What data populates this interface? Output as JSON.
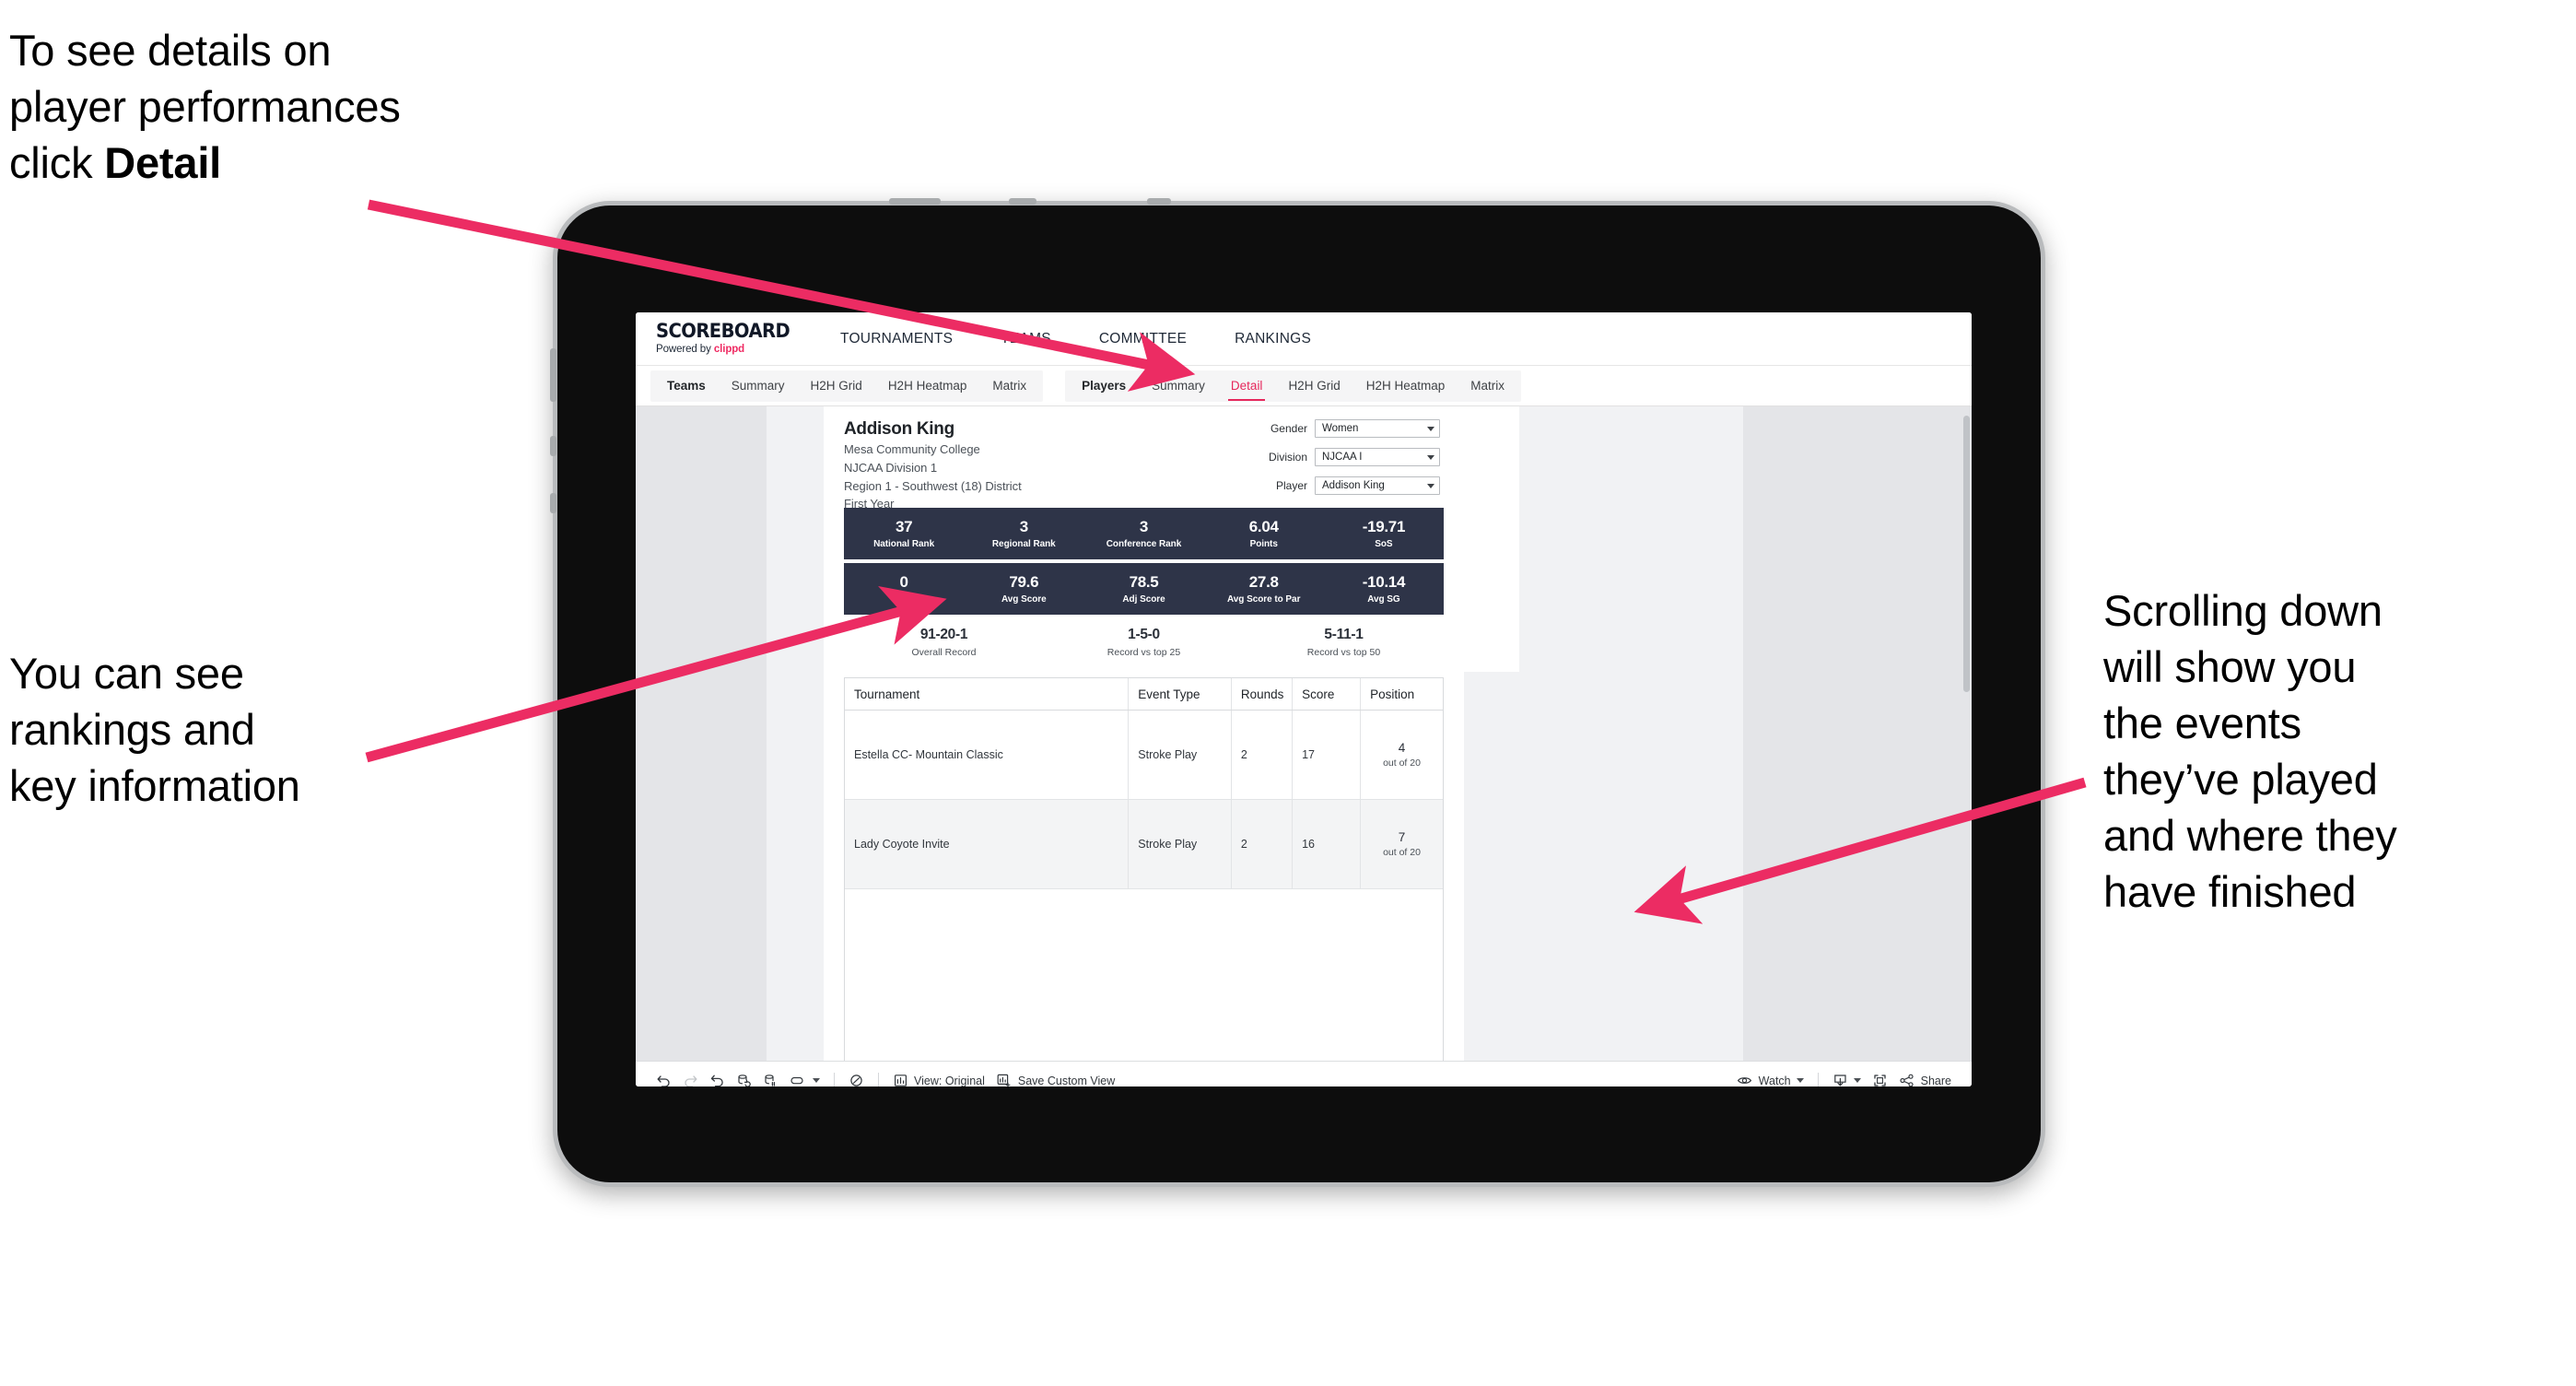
{
  "annotations": {
    "top_left": {
      "line1": "To see details on",
      "line2": "player performances",
      "line3_prefix": "click ",
      "line3_bold": "Detail"
    },
    "mid_left": "You can see\nrankings and\nkey information",
    "right": "Scrolling down\nwill show you\nthe events\nthey’ve played\nand where they\nhave finished"
  },
  "colors": {
    "arrow_pink": "#ec2c63",
    "accent_pink": "#e6285c",
    "band_navy": "#2e3448",
    "brand_pink": "#ef2b63"
  },
  "app": {
    "brand": {
      "title": "SCOREBOARD",
      "powered_prefix": "Powered by ",
      "powered_name": "clippd"
    },
    "top_nav": [
      {
        "label": "TOURNAMENTS"
      },
      {
        "label": "TEAMS"
      },
      {
        "label": "COMMITTEE"
      },
      {
        "label": "RANKINGS"
      }
    ],
    "sub_nav": {
      "teams_group": [
        {
          "label": "Teams",
          "lead": true,
          "active": false
        },
        {
          "label": "Summary",
          "lead": false,
          "active": false
        },
        {
          "label": "H2H Grid",
          "lead": false,
          "active": false
        },
        {
          "label": "H2H Heatmap",
          "lead": false,
          "active": false
        },
        {
          "label": "Matrix",
          "lead": false,
          "active": false
        }
      ],
      "players_group": [
        {
          "label": "Players",
          "lead": true,
          "active": false
        },
        {
          "label": "Summary",
          "lead": false,
          "active": false
        },
        {
          "label": "Detail",
          "lead": false,
          "active": true
        },
        {
          "label": "H2H Grid",
          "lead": false,
          "active": false
        },
        {
          "label": "H2H Heatmap",
          "lead": false,
          "active": false
        },
        {
          "label": "Matrix",
          "lead": false,
          "active": false
        }
      ]
    }
  },
  "player": {
    "name": "Addison King",
    "school": "Mesa Community College",
    "division": "NJCAA Division 1",
    "region": "Region 1 - Southwest (18) District",
    "class_year": "First Year"
  },
  "filters": [
    {
      "label": "Gender",
      "value": "Women"
    },
    {
      "label": "Division",
      "value": "NJCAA I"
    },
    {
      "label": "Player",
      "value": "Addison King"
    }
  ],
  "stats_band_1": [
    {
      "value": "37",
      "label": "National Rank"
    },
    {
      "value": "3",
      "label": "Regional Rank"
    },
    {
      "value": "3",
      "label": "Conference Rank"
    },
    {
      "value": "6.04",
      "label": "Points"
    },
    {
      "value": "-19.71",
      "label": "SoS"
    }
  ],
  "stats_band_2": [
    {
      "value": "0",
      "label": "Wins"
    },
    {
      "value": "79.6",
      "label": "Avg Score"
    },
    {
      "value": "78.5",
      "label": "Adj Score"
    },
    {
      "value": "27.8",
      "label": "Avg Score to Par"
    },
    {
      "value": "-10.14",
      "label": "Avg SG"
    }
  ],
  "records": [
    {
      "value": "91-20-1",
      "label": "Overall Record"
    },
    {
      "value": "1-5-0",
      "label": "Record vs top 25"
    },
    {
      "value": "5-11-1",
      "label": "Record vs top 50"
    }
  ],
  "table": {
    "headers": [
      "Tournament",
      "Event Type",
      "Rounds",
      "Score",
      "Position"
    ],
    "rows": [
      {
        "tournament": "Estella CC- Mountain Classic",
        "event_type": "Stroke Play",
        "rounds": "2",
        "score": "17",
        "position": "4",
        "position_sub": "out of 20"
      },
      {
        "tournament": "Lady Coyote Invite",
        "event_type": "Stroke Play",
        "rounds": "2",
        "score": "16",
        "position": "7",
        "position_sub": "out of 20"
      }
    ]
  },
  "toolbar": {
    "undo": "undo-icon",
    "redo": "redo-icon",
    "revert": "revert-icon",
    "refresh": "refresh-data-icon",
    "pause": "pause-auto-update-icon",
    "view_original_label": "View: Original",
    "save_custom_view_label": "Save Custom View",
    "watch_label": "Watch",
    "share_label": "Share"
  }
}
